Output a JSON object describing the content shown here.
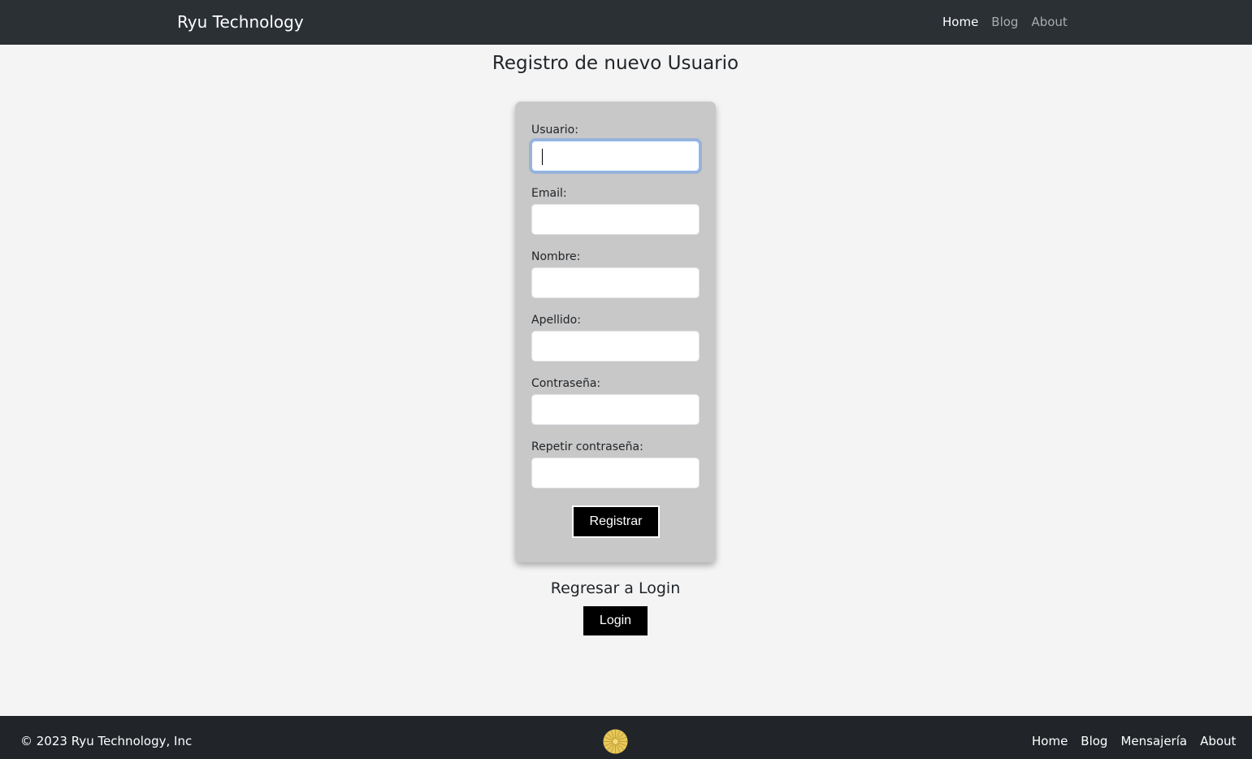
{
  "navbar": {
    "brand": "Ryu Technology",
    "links": [
      {
        "label": "Home"
      },
      {
        "label": "Blog"
      },
      {
        "label": "About"
      }
    ]
  },
  "page_title": "Registro de nuevo Usuario",
  "form": {
    "fields": [
      {
        "label": "Usuario:",
        "value": "",
        "focused": true
      },
      {
        "label": "Email:",
        "value": ""
      },
      {
        "label": "Nombre:",
        "value": ""
      },
      {
        "label": "Apellido:",
        "value": ""
      },
      {
        "label": "Contraseña:",
        "value": ""
      },
      {
        "label": "Repetir contraseña:",
        "value": ""
      }
    ],
    "submit_label": "Registrar"
  },
  "back": {
    "title": "Regresar a Login",
    "button_label": "Login"
  },
  "footer": {
    "copyright": "© 2023 Ryu Technology, Inc",
    "logo_icon": "chrysanthemum-seal-icon",
    "links": [
      {
        "label": "Home"
      },
      {
        "label": "Blog"
      },
      {
        "label": "Mensajería"
      },
      {
        "label": "About"
      }
    ]
  },
  "colors": {
    "navbar_bg": "#2b3035",
    "footer_bg": "#212529",
    "card_bg": "#c8c8c8",
    "page_bg": "#f4f4f4",
    "button_bg": "#000000",
    "focus_ring": "#86b7fe",
    "logo_gold": "#e8c85a"
  }
}
